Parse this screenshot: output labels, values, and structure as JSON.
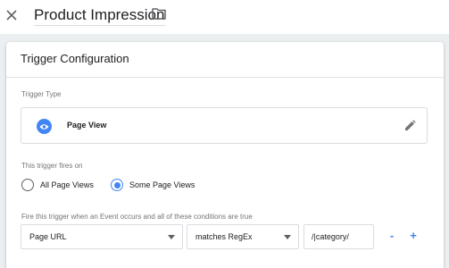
{
  "header": {
    "title": "Product Impression",
    "close_icon": "close-icon",
    "folder_icon": "folder-icon"
  },
  "panel": {
    "title": "Trigger Configuration",
    "trigger_type": {
      "label": "Trigger Type",
      "value": "Page View",
      "icon": "eye-icon",
      "edit_icon": "pencil-icon"
    },
    "fires_on": {
      "label": "This trigger fires on",
      "options": [
        {
          "label": "All Page Views",
          "checked": false
        },
        {
          "label": "Some Page Views",
          "checked": true
        }
      ]
    },
    "conditions": {
      "label": "Fire this trigger when an Event occurs and all of these conditions are true",
      "variable": "Page URL",
      "operator": "matches RegEx",
      "value": "/|category/",
      "remove_label": "-",
      "add_label": "+"
    }
  },
  "colors": {
    "accent": "#4285f4",
    "background": "#eceff1"
  }
}
